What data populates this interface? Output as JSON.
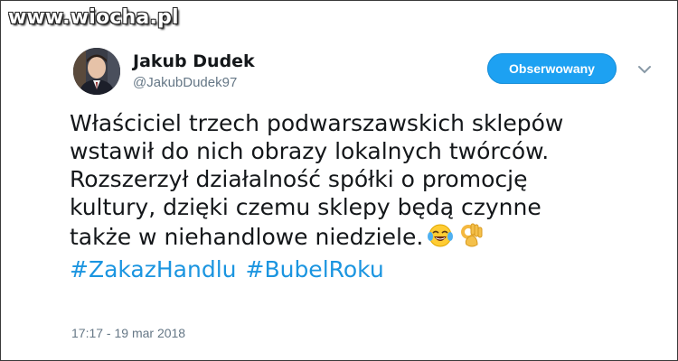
{
  "watermark": "www.wiocha.pl",
  "author": {
    "name": "Jakub Dudek",
    "handle": "@JakubDudek97"
  },
  "follow_button_label": "Obserwowany",
  "tweet": {
    "lines": [
      "Właściciel trzech podwarszawskich sklepów",
      "wstawił do nich obrazy lokalnych twórców.",
      "Rozszerzył działalność spółki o promocję",
      "kultury, dzięki czemu sklepy będą czynne",
      "także w niehandlowe niedziele."
    ],
    "emojis": [
      "tears-of-joy-emoji",
      "ok-hand-emoji"
    ],
    "hashtags": [
      "#ZakazHandlu",
      "#BubelRoku"
    ]
  },
  "timestamp": "17:17 - 19 mar 2018",
  "colors": {
    "accent": "#1da1f2",
    "hashtag": "#1b95e0",
    "secondary_text": "#657786"
  }
}
